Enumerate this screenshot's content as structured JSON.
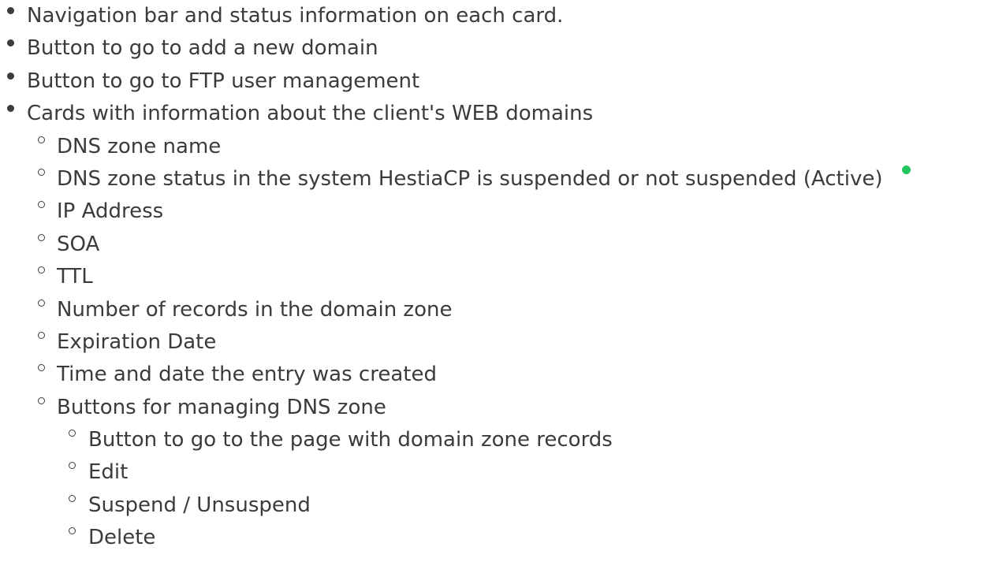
{
  "colors": {
    "text": "#3b3b3b",
    "status_active": "#22c55e"
  },
  "items": [
    "Navigation bar and status information on each card.",
    "Button to go to add a new domain",
    "Button to go to FTP user management",
    "Cards with information about the client's WEB domains"
  ],
  "card_fields": [
    "DNS zone name",
    "DNS zone status in the system HestiaCP is suspended or not suspended (Active)",
    "IP Address",
    "SOA",
    "TTL",
    "Number of records in the domain zone",
    "Expiration Date",
    "Time and date the entry was created",
    "Buttons for managing DNS zone"
  ],
  "status_icon": "green-status-dot-icon",
  "management_buttons": [
    "Button to go to the page with domain zone records",
    "Edit",
    "Suspend / Unsuspend",
    "Delete"
  ]
}
